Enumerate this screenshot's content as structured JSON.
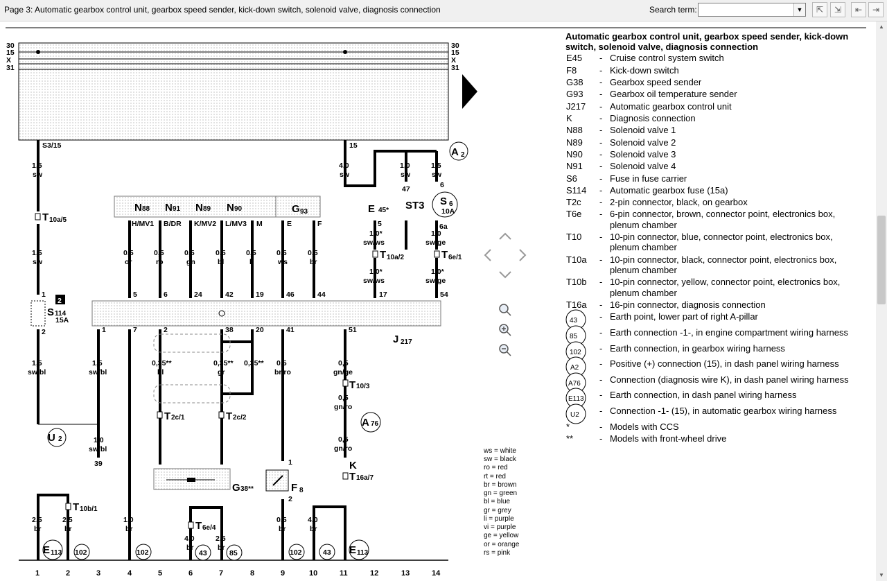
{
  "toolbar": {
    "title": "Page 3: Automatic gearbox control unit, gearbox speed sender, kick-down switch, solenoid valve, diagnosis connection",
    "search_label": "Search term:",
    "search_value": ""
  },
  "legend": {
    "title_line1": "Automatic gearbox control unit, gearbox speed sender, kick-down",
    "title_line2": "switch, solenoid valve, diagnosis connection",
    "items": [
      {
        "code": "E45",
        "text": "Cruise control system switch"
      },
      {
        "code": "F8",
        "text": "Kick-down switch"
      },
      {
        "code": "G38",
        "text": "Gearbox speed sender"
      },
      {
        "code": "G93",
        "text": "Gearbox oil temperature sender"
      },
      {
        "code": "J217",
        "text": "Automatic gearbox control unit"
      },
      {
        "code": "K",
        "text": "Diagnosis connection"
      },
      {
        "code": "N88",
        "text": "Solenoid valve 1"
      },
      {
        "code": "N89",
        "text": "Solenoid valve 2"
      },
      {
        "code": "N90",
        "text": "Solenoid valve 3"
      },
      {
        "code": "N91",
        "text": "Solenoid valve 4"
      },
      {
        "code": "S6",
        "text": "Fuse in fuse carrier"
      },
      {
        "code": "S114",
        "text": "Automatic gearbox fuse (15a)"
      },
      {
        "code": "T2c",
        "text": "2-pin connector, black, on gearbox"
      },
      {
        "code": "T6e",
        "text": "6-pin connector, brown, connector point, electronics box,",
        "text2": "plenum chamber"
      },
      {
        "code": "T10",
        "text": "10-pin connector, blue, connector point, electronics box,",
        "text2": "plenum chamber"
      },
      {
        "code": "T10a",
        "text": "10-pin connector, black, connector point, electronics box,",
        "text2": "plenum chamber"
      },
      {
        "code": "T10b",
        "text": "10-pin connector, yellow, connector point, electronics box,",
        "text2": "plenum chamber"
      },
      {
        "code": "T16a",
        "text": "16-pin connector, diagnosis connection"
      }
    ],
    "circle_items": [
      {
        "code": "43",
        "text": "Earth point, lower part of right A-pillar"
      },
      {
        "code": "85",
        "text": "Earth connection -1-, in engine compartment wiring harness"
      },
      {
        "code": "102",
        "text": "Earth connection, in gearbox wiring harness"
      },
      {
        "code": "A2",
        "text": "Positive (+) connection (15), in dash panel wiring harness"
      },
      {
        "code": "A76",
        "text": "Connection (diagnosis wire K), in dash panel wiring harness"
      },
      {
        "code": "E113",
        "text": "Earth connection, in dash panel wiring harness"
      },
      {
        "code": "U2",
        "text": "Connection -1- (15), in automatic gearbox wiring harness"
      }
    ],
    "notes": [
      {
        "mark": "*",
        "text": "Models with CCS"
      },
      {
        "mark": "**",
        "text": "Models with front-wheel drive"
      }
    ]
  },
  "colors_key": [
    "ws = white",
    "sw = black",
    "ro = red",
    "rt = red",
    "br = brown",
    "gn = green",
    "bl = blue",
    "gr = grey",
    "li = purple",
    "vi = purple",
    "ge = yellow",
    "or = orange",
    "rs = pink"
  ],
  "diagram": {
    "rail_labels": [
      "30",
      "15",
      "X",
      "31"
    ],
    "column_numbers": [
      "1",
      "2",
      "3",
      "4",
      "5",
      "6",
      "7",
      "8",
      "9",
      "10",
      "11",
      "12",
      "13",
      "14"
    ],
    "labels": {
      "s3_15": "S3/15",
      "p15": "15",
      "a2": "A",
      "a2sub": "2",
      "w1_5a": "1,5",
      "sw": "sw",
      "w4_0": "4,0",
      "sw2": "sw",
      "w1_0": "1,0",
      "sw3": "sw",
      "p47": "47",
      "w1_5b": "1,5",
      "sw4": "sw",
      "p6": "6",
      "e45": "E",
      "e45sub": "45*",
      "st3": "ST3",
      "s6": "S",
      "s6sub": "6",
      "s6amp": "10A",
      "p6a": "6a",
      "n88": "N",
      "n88s": "88",
      "n91": "N",
      "n91s": "91",
      "n89": "N",
      "n89s": "89",
      "n90": "N",
      "n90s": "90",
      "g93": "G",
      "g93s": "93",
      "pinH": "H/MV1",
      "pinB": "B/DR",
      "pinK": "K/MV2",
      "pinL": "L/MV3",
      "pinM": "M",
      "pinE": "E",
      "pinF": "F",
      "t10a5": "T",
      "t10a5s": "10a/5",
      "p5e": "5",
      "w10a": "1,0*",
      "swws": "sw/ws",
      "t10a2": "T",
      "t10a2s": "10a/2",
      "w10b": "1,0*",
      "swws2": "sw/ws",
      "w10c": "1,0",
      "swge": "sw/ge",
      "t6e1": "T",
      "t6e1s": "6e/1",
      "w10d": "1,0*",
      "swge2": "sw/ge",
      "w05_1": "0,5",
      "or": "or",
      "w05_2": "0,5",
      "ro": "ro",
      "w05_3": "0,5",
      "gn": "gn",
      "w05_4": "0,5",
      "bl": "bl",
      "w05_5": "0,5",
      "li": "li",
      "w05_6": "0,5",
      "ws": "ws",
      "w05_7": "0,5",
      "br": "br",
      "w15c": "1,5",
      "sw5": "sw",
      "pj5": "5",
      "pj6": "6",
      "pj24": "24",
      "pj42": "42",
      "pj19": "19",
      "pj46": "46",
      "pj44": "44",
      "pj17": "17",
      "pj54": "54",
      "s114": "S",
      "s114s": "114",
      "s114a": "15A",
      "s114n": "2",
      "p1a": "1",
      "p2": "2",
      "p1": "1",
      "p7": "7",
      "p2b": "2",
      "p38": "38",
      "p20": "20",
      "p41": "41",
      "p51": "51",
      "j217": "J",
      "j217s": "217",
      "w15d": "1,5",
      "swbl": "sw/bl",
      "w15e": "1,5",
      "swbl2": "sw/bl",
      "w035a": "0,35**",
      "bl2": "bl",
      "w035b": "0,35**",
      "gr": "gr",
      "w035c": "0,35**",
      "w05_8": "0,5",
      "brro": "br/ro",
      "w05_9": "0,5",
      "gnge": "gn/ge",
      "t10_3": "T",
      "t10_3s": "10/3",
      "w05_10": "0,5",
      "gnro": "gn/ro",
      "a76": "A",
      "a76s": "76",
      "w05_11": "0,5",
      "gnro2": "gn/ro",
      "k": "K",
      "t16a7": "T",
      "t16a7s": "16a/7",
      "u2": "U",
      "u2s": "2",
      "w10e": "1,0",
      "swbl3": "sw/bl",
      "p39": "39",
      "t2c1": "T",
      "t2c1s": "2c/1",
      "t2c2": "T",
      "t2c2s": "2c/2",
      "g38": "G",
      "g38s": "38**",
      "f8": "F",
      "f8s": "8",
      "pf1": "1",
      "pf2": "2",
      "t10b1": "T",
      "t10b1s": "10b/1",
      "t6e4": "T",
      "t6e4s": "6e/4",
      "w25a": "2,5",
      "br1": "br",
      "w25b": "2,5",
      "br2": "br",
      "w10f": "1,0",
      "br3": "br",
      "w40b": "4,0",
      "br4": "br",
      "w25c": "2,5",
      "br5": "br",
      "w05_12": "0,5",
      "br6": "br",
      "w40c": "4,0",
      "br7": "br",
      "e113a": "E",
      "e113as": "113",
      "g102a": "102",
      "g102b": "102",
      "g43a": "43",
      "g85": "85",
      "g102c": "102",
      "g43b": "43",
      "e113b": "E",
      "e113bs": "113"
    }
  }
}
